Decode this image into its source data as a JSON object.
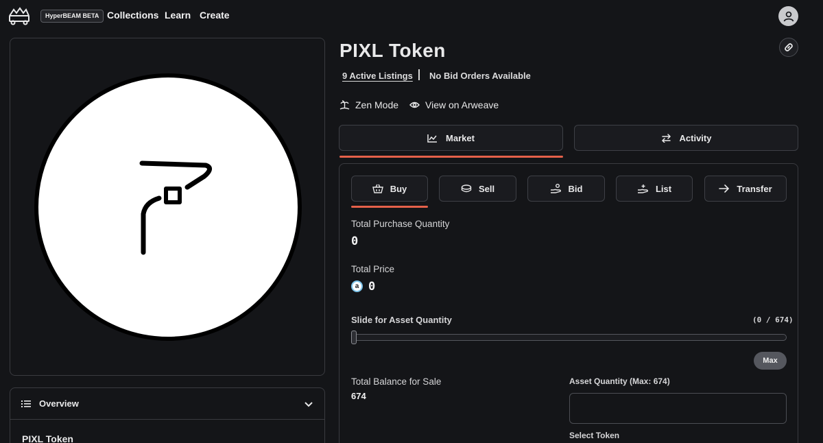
{
  "header": {
    "badge": "HyperBEAM BETA",
    "nav": [
      "Collections",
      "Learn",
      "Create"
    ]
  },
  "asset": {
    "title": "PIXL Token",
    "active_listings": "9 Active Listings",
    "bid_status": "No Bid Orders Available",
    "actions": {
      "zen_mode": "Zen Mode",
      "view_on_arweave": "View on Arweave"
    }
  },
  "tabs": {
    "market": "Market",
    "activity": "Activity",
    "active": "Market"
  },
  "trade": {
    "sub_tabs": [
      "Buy",
      "Sell",
      "Bid",
      "List",
      "Transfer"
    ],
    "active_sub_tab": "Buy",
    "total_purchase_quantity_label": "Total Purchase Quantity",
    "total_purchase_quantity": "0",
    "total_price_label": "Total Price",
    "total_price": "0",
    "currency_icon_letter": "a",
    "slider_label": "Slide for Asset Quantity",
    "slider_range": "(0 / 674)",
    "slider_value_fraction": 0,
    "max_button": "Max",
    "total_balance_label": "Total Balance for Sale",
    "total_balance": "674",
    "asset_quantity_label": "Asset Quantity (Max: 674)",
    "asset_quantity_value": "",
    "select_token_label": "Select Token"
  },
  "overview": {
    "title": "Overview",
    "name": "PIXL Token"
  },
  "colors": {
    "background": "#141518",
    "accent": "#e5614a",
    "border": "#3a3b40"
  }
}
